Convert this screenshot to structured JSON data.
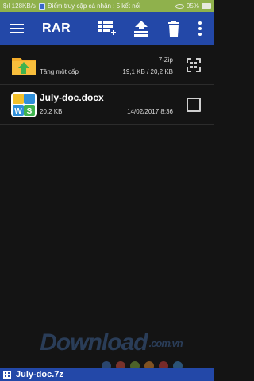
{
  "status_bar": {
    "left_text": "$ıl 128KB/s",
    "notification": "Điểm truy cập cá nhân : 5 kết nối",
    "battery": "95%"
  },
  "app_bar": {
    "title": "RAR",
    "icons": [
      "menu-icon",
      "add-to-archive-icon",
      "extract-icon",
      "delete-icon",
      "more-vert-icon"
    ]
  },
  "files": [
    {
      "name": "",
      "label": "Tầng một cấp",
      "type_text": "7-Zip",
      "size_text": "19,1 KB / 20,2 KB",
      "icon": "folder-up-icon"
    },
    {
      "name": "July-doc.docx",
      "size_text": "20,2 KB",
      "date_text": "14/02/2017 8:36",
      "icon": "wps-doc-icon"
    }
  ],
  "watermark": {
    "main": "Download",
    "suffix": ".com.vn"
  },
  "dots_colors": [
    "#3c6fb8",
    "#c84b3f",
    "#7aa33b",
    "#d9852e",
    "#c63d3d",
    "#3e86c8"
  ],
  "bottom_bar": {
    "archive_name": "July-doc.7z"
  },
  "colors": {
    "accent": "#2348a8",
    "status_bar": "#8fb14c",
    "background": "#141414"
  }
}
